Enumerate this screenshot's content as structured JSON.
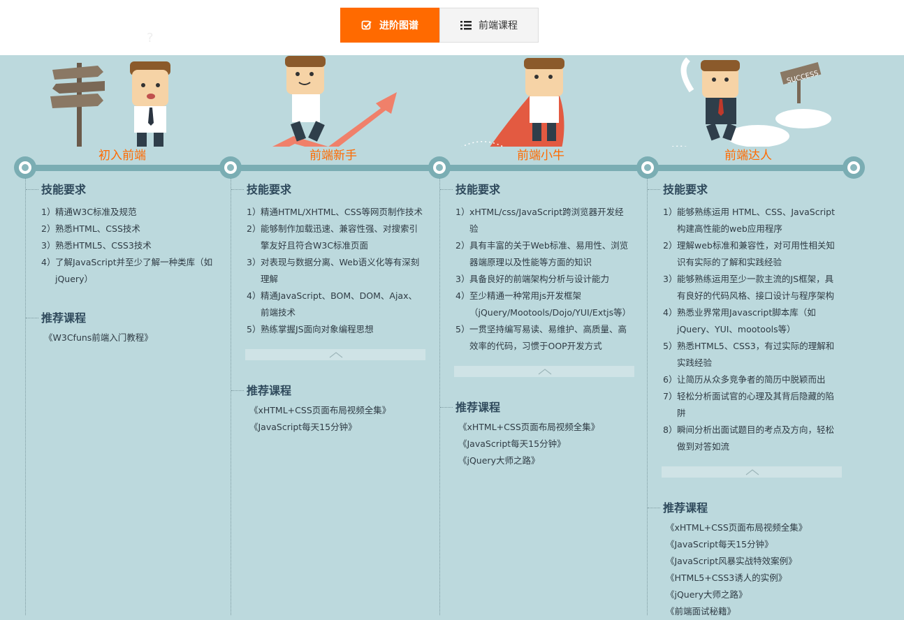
{
  "tabs": [
    {
      "label": "进阶图谱",
      "icon": "checkbox-icon",
      "active": true
    },
    {
      "label": "前端课程",
      "icon": "list-icon",
      "active": false
    }
  ],
  "colors": {
    "accent": "#ff6a00",
    "timeline": "#7aadb3",
    "background": "#bcd9dd"
  },
  "stages": [
    {
      "title": "初入前端",
      "skills_heading": "技能要求",
      "skills": [
        {
          "num": "1）",
          "text": "精通W3C标准及规范"
        },
        {
          "num": "2）",
          "text": "熟悉HTML、CSS技术"
        },
        {
          "num": "3）",
          "text": "熟悉HTML5、CSS3技术"
        },
        {
          "num": "4）",
          "text": "了解JavaScript并至少了解一种类库（如jQuery）"
        }
      ],
      "courses_heading": "推荐课程",
      "courses": [
        "《W3Cfuns前端入门教程》"
      ]
    },
    {
      "title": "前端新手",
      "skills_heading": "技能要求",
      "skills": [
        {
          "num": "1）",
          "text": "精通HTML/XHTML、CSS等网页制作技术"
        },
        {
          "num": "2）",
          "text": "能够制作加载迅速、兼容性强、对搜索引擎友好且符合W3C标准页面"
        },
        {
          "num": "3）",
          "text": "对表现与数据分离、Web语义化等有深刻理解"
        },
        {
          "num": "4）",
          "text": "精通JavaScript、BOM、DOM、Ajax、前端技术"
        },
        {
          "num": "5）",
          "text": "熟练掌握JS面向对象编程思想"
        }
      ],
      "courses_heading": "推荐课程",
      "courses": [
        "《xHTML+CSS页面布局视频全集》",
        "《JavaScript每天15分钟》"
      ]
    },
    {
      "title": "前端小牛",
      "skills_heading": "技能要求",
      "skills": [
        {
          "num": "1）",
          "text": "xHTML/css/JavaScript跨浏览器开发经验"
        },
        {
          "num": "2）",
          "text": "具有丰富的关于Web标准、易用性、浏览器端原理以及性能等方面的知识"
        },
        {
          "num": "3）",
          "text": "具备良好的前端架构分析与设计能力"
        },
        {
          "num": "4）",
          "text": "至少精通一种常用js开发框架（jQuery/Mootools/Dojo/YUI/Extjs等）"
        },
        {
          "num": "5）",
          "text": "一贯坚持编写易读、易维护、高质量、高效率的代码，习惯于OOP开发方式"
        }
      ],
      "courses_heading": "推荐课程",
      "courses": [
        "《xHTML+CSS页面布局视频全集》",
        "《JavaScript每天15分钟》",
        "《jQuery大师之路》"
      ]
    },
    {
      "title": "前端达人",
      "skills_heading": "技能要求",
      "skills": [
        {
          "num": "1）",
          "text": "能够熟练运用 HTML、CSS、JavaScript构建高性能的web应用程序"
        },
        {
          "num": "2）",
          "text": "理解web标准和兼容性，对可用性相关知识有实际的了解和实践经验"
        },
        {
          "num": "3）",
          "text": "能够熟练运用至少一款主流的JS框架，具有良好的代码风格、接口设计与程序架构"
        },
        {
          "num": "4）",
          "text": "熟悉业界常用Javascript脚本库（如jQuery、YUI、mootools等）"
        },
        {
          "num": "5）",
          "text": "熟悉HTML5、CSS3，有过实际的理解和实践经验"
        },
        {
          "num": "6）",
          "text": "让简历从众多竞争者的简历中脱颖而出"
        },
        {
          "num": "7）",
          "text": "轻松分析面试官的心理及其背后隐藏的陷阱"
        },
        {
          "num": "8）",
          "text": "瞬间分析出面试题目的考点及方向，轻松做到对答如流"
        }
      ],
      "courses_heading": "推荐课程",
      "courses": [
        "《xHTML+CSS页面布局视频全集》",
        "《JavaScript每天15分钟》",
        "《JavaScript风暴实战特效案例》",
        "《HTML5+CSS3诱人的实例》",
        "《jQuery大师之路》",
        "《前端面试秘籍》"
      ]
    }
  ],
  "success_sign": "SUCCESS"
}
